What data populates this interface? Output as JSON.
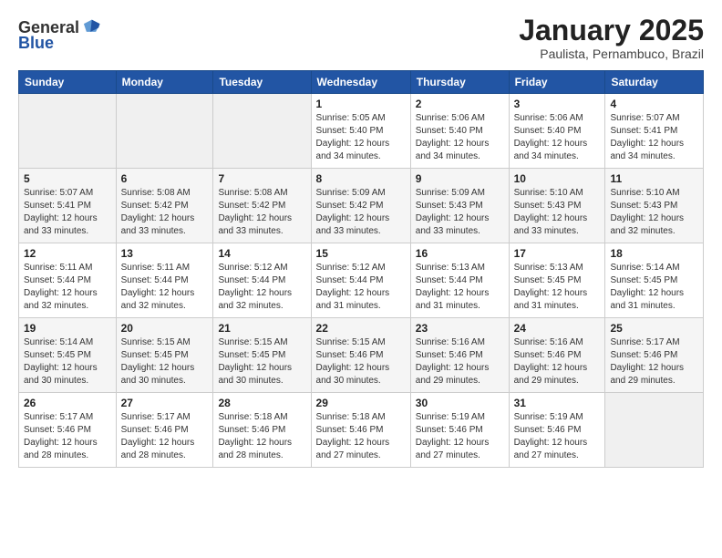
{
  "header": {
    "logo_general": "General",
    "logo_blue": "Blue",
    "month_title": "January 2025",
    "location": "Paulista, Pernambuco, Brazil"
  },
  "weekdays": [
    "Sunday",
    "Monday",
    "Tuesday",
    "Wednesday",
    "Thursday",
    "Friday",
    "Saturday"
  ],
  "weeks": [
    [
      {
        "day": "",
        "sunrise": "",
        "sunset": "",
        "daylight": ""
      },
      {
        "day": "",
        "sunrise": "",
        "sunset": "",
        "daylight": ""
      },
      {
        "day": "",
        "sunrise": "",
        "sunset": "",
        "daylight": ""
      },
      {
        "day": "1",
        "sunrise": "Sunrise: 5:05 AM",
        "sunset": "Sunset: 5:40 PM",
        "daylight": "Daylight: 12 hours and 34 minutes."
      },
      {
        "day": "2",
        "sunrise": "Sunrise: 5:06 AM",
        "sunset": "Sunset: 5:40 PM",
        "daylight": "Daylight: 12 hours and 34 minutes."
      },
      {
        "day": "3",
        "sunrise": "Sunrise: 5:06 AM",
        "sunset": "Sunset: 5:40 PM",
        "daylight": "Daylight: 12 hours and 34 minutes."
      },
      {
        "day": "4",
        "sunrise": "Sunrise: 5:07 AM",
        "sunset": "Sunset: 5:41 PM",
        "daylight": "Daylight: 12 hours and 34 minutes."
      }
    ],
    [
      {
        "day": "5",
        "sunrise": "Sunrise: 5:07 AM",
        "sunset": "Sunset: 5:41 PM",
        "daylight": "Daylight: 12 hours and 33 minutes."
      },
      {
        "day": "6",
        "sunrise": "Sunrise: 5:08 AM",
        "sunset": "Sunset: 5:42 PM",
        "daylight": "Daylight: 12 hours and 33 minutes."
      },
      {
        "day": "7",
        "sunrise": "Sunrise: 5:08 AM",
        "sunset": "Sunset: 5:42 PM",
        "daylight": "Daylight: 12 hours and 33 minutes."
      },
      {
        "day": "8",
        "sunrise": "Sunrise: 5:09 AM",
        "sunset": "Sunset: 5:42 PM",
        "daylight": "Daylight: 12 hours and 33 minutes."
      },
      {
        "day": "9",
        "sunrise": "Sunrise: 5:09 AM",
        "sunset": "Sunset: 5:43 PM",
        "daylight": "Daylight: 12 hours and 33 minutes."
      },
      {
        "day": "10",
        "sunrise": "Sunrise: 5:10 AM",
        "sunset": "Sunset: 5:43 PM",
        "daylight": "Daylight: 12 hours and 33 minutes."
      },
      {
        "day": "11",
        "sunrise": "Sunrise: 5:10 AM",
        "sunset": "Sunset: 5:43 PM",
        "daylight": "Daylight: 12 hours and 32 minutes."
      }
    ],
    [
      {
        "day": "12",
        "sunrise": "Sunrise: 5:11 AM",
        "sunset": "Sunset: 5:44 PM",
        "daylight": "Daylight: 12 hours and 32 minutes."
      },
      {
        "day": "13",
        "sunrise": "Sunrise: 5:11 AM",
        "sunset": "Sunset: 5:44 PM",
        "daylight": "Daylight: 12 hours and 32 minutes."
      },
      {
        "day": "14",
        "sunrise": "Sunrise: 5:12 AM",
        "sunset": "Sunset: 5:44 PM",
        "daylight": "Daylight: 12 hours and 32 minutes."
      },
      {
        "day": "15",
        "sunrise": "Sunrise: 5:12 AM",
        "sunset": "Sunset: 5:44 PM",
        "daylight": "Daylight: 12 hours and 31 minutes."
      },
      {
        "day": "16",
        "sunrise": "Sunrise: 5:13 AM",
        "sunset": "Sunset: 5:44 PM",
        "daylight": "Daylight: 12 hours and 31 minutes."
      },
      {
        "day": "17",
        "sunrise": "Sunrise: 5:13 AM",
        "sunset": "Sunset: 5:45 PM",
        "daylight": "Daylight: 12 hours and 31 minutes."
      },
      {
        "day": "18",
        "sunrise": "Sunrise: 5:14 AM",
        "sunset": "Sunset: 5:45 PM",
        "daylight": "Daylight: 12 hours and 31 minutes."
      }
    ],
    [
      {
        "day": "19",
        "sunrise": "Sunrise: 5:14 AM",
        "sunset": "Sunset: 5:45 PM",
        "daylight": "Daylight: 12 hours and 30 minutes."
      },
      {
        "day": "20",
        "sunrise": "Sunrise: 5:15 AM",
        "sunset": "Sunset: 5:45 PM",
        "daylight": "Daylight: 12 hours and 30 minutes."
      },
      {
        "day": "21",
        "sunrise": "Sunrise: 5:15 AM",
        "sunset": "Sunset: 5:45 PM",
        "daylight": "Daylight: 12 hours and 30 minutes."
      },
      {
        "day": "22",
        "sunrise": "Sunrise: 5:15 AM",
        "sunset": "Sunset: 5:46 PM",
        "daylight": "Daylight: 12 hours and 30 minutes."
      },
      {
        "day": "23",
        "sunrise": "Sunrise: 5:16 AM",
        "sunset": "Sunset: 5:46 PM",
        "daylight": "Daylight: 12 hours and 29 minutes."
      },
      {
        "day": "24",
        "sunrise": "Sunrise: 5:16 AM",
        "sunset": "Sunset: 5:46 PM",
        "daylight": "Daylight: 12 hours and 29 minutes."
      },
      {
        "day": "25",
        "sunrise": "Sunrise: 5:17 AM",
        "sunset": "Sunset: 5:46 PM",
        "daylight": "Daylight: 12 hours and 29 minutes."
      }
    ],
    [
      {
        "day": "26",
        "sunrise": "Sunrise: 5:17 AM",
        "sunset": "Sunset: 5:46 PM",
        "daylight": "Daylight: 12 hours and 28 minutes."
      },
      {
        "day": "27",
        "sunrise": "Sunrise: 5:17 AM",
        "sunset": "Sunset: 5:46 PM",
        "daylight": "Daylight: 12 hours and 28 minutes."
      },
      {
        "day": "28",
        "sunrise": "Sunrise: 5:18 AM",
        "sunset": "Sunset: 5:46 PM",
        "daylight": "Daylight: 12 hours and 28 minutes."
      },
      {
        "day": "29",
        "sunrise": "Sunrise: 5:18 AM",
        "sunset": "Sunset: 5:46 PM",
        "daylight": "Daylight: 12 hours and 27 minutes."
      },
      {
        "day": "30",
        "sunrise": "Sunrise: 5:19 AM",
        "sunset": "Sunset: 5:46 PM",
        "daylight": "Daylight: 12 hours and 27 minutes."
      },
      {
        "day": "31",
        "sunrise": "Sunrise: 5:19 AM",
        "sunset": "Sunset: 5:46 PM",
        "daylight": "Daylight: 12 hours and 27 minutes."
      },
      {
        "day": "",
        "sunrise": "",
        "sunset": "",
        "daylight": ""
      }
    ]
  ]
}
